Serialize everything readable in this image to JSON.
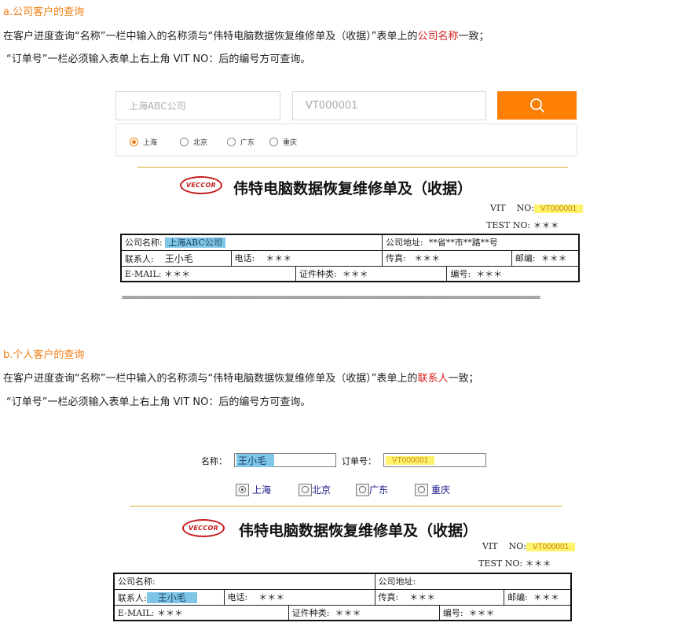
{
  "sectionA": {
    "title": "a.公司客户的查询",
    "line1_pre": "在客户进度查询“名称”一栏中输入的名称须与“伟特电脑数据恢复维修单及（收据）”表单上的",
    "line1_highlight": "公司名称",
    "line1_post": "一致；",
    "line2": "“订单号”一栏必须输入表单上右上角 VIT NO：后的编号方可查询。",
    "search": {
      "name_placeholder": "上海ABC公司",
      "order_placeholder": "VT000001",
      "button_icon": "search-icon",
      "cities": [
        "上海",
        "北京",
        "广东",
        "重庆"
      ],
      "selected_city": "上海"
    },
    "form": {
      "logo_text": "VECCOR",
      "title": "伟特电脑数据恢复维修单及（收据）",
      "vit_label": "VIT",
      "no_label": "NO:",
      "vit_no": "VT000001",
      "test_no_label": "TEST NO:",
      "test_no_value": "＊＊＊",
      "company_label": "公司名称:",
      "company_value": "上海ABC公司",
      "address_label": "公司地址:",
      "address_value": "**省**市**路**号",
      "contact_label": "联系人:",
      "contact_value": "王小毛",
      "phone_label": "电话:",
      "phone_value": "＊＊＊",
      "fax_label": "传真:",
      "fax_value": "＊＊＊",
      "zip_label": "邮编:",
      "zip_value": "＊＊＊",
      "email_label": "E-MAIL:",
      "email_value": "＊＊＊",
      "id_label": "证件种类:",
      "id_value": "＊＊＊",
      "num_label": "编号:",
      "num_value": "＊＊＊",
      "separator": "=========================================================================================================="
    }
  },
  "sectionB": {
    "title": "b.个人客户的查询",
    "line1_pre": "在客户进度查询“名称”一栏中输入的名称须与“伟特电脑数据恢复维修单及（收据）”表单上的",
    "line1_highlight": "联系人",
    "line1_post": "一致；",
    "line2": "“订单号”一栏必须输入表单上右上角 VIT NO：后的编号方可查询。",
    "search": {
      "name_label": "名称：",
      "name_value": "王小毛",
      "order_label": "订单号：",
      "order_value": "VT000001",
      "cities": [
        "上海",
        "北京",
        "广东",
        "重庆"
      ],
      "selected_city": "上海"
    },
    "form": {
      "logo_text": "VECCOR",
      "title": "伟特电脑数据恢复维修单及（收据）",
      "vit_label": "VIT",
      "no_label": "NO:",
      "vit_no": "VT000001",
      "test_no_label": "TEST NO:",
      "test_no_value": "＊＊＊",
      "company_label": "公司名称:",
      "address_label": "公司地址:",
      "contact_label": "联系人:",
      "contact_value": "王小毛",
      "phone_label": "电话:",
      "phone_value": "＊＊＊",
      "fax_label": "传真:",
      "fax_value": "＊＊＊",
      "zip_label": "邮编:",
      "zip_value": "＊＊＊",
      "email_label": "E-MAIL:",
      "email_value": "＊＊＊",
      "id_label": "证件种类:",
      "id_value": "＊＊＊",
      "num_label": "编号:",
      "num_value": "＊＊＊"
    }
  },
  "colors": {
    "accent_orange": "#f07d12",
    "button_orange": "#fd7f04",
    "highlight_red": "#d51d1d",
    "highlight_yellow": "#fff36b",
    "highlight_blue": "#7ec6e6"
  }
}
